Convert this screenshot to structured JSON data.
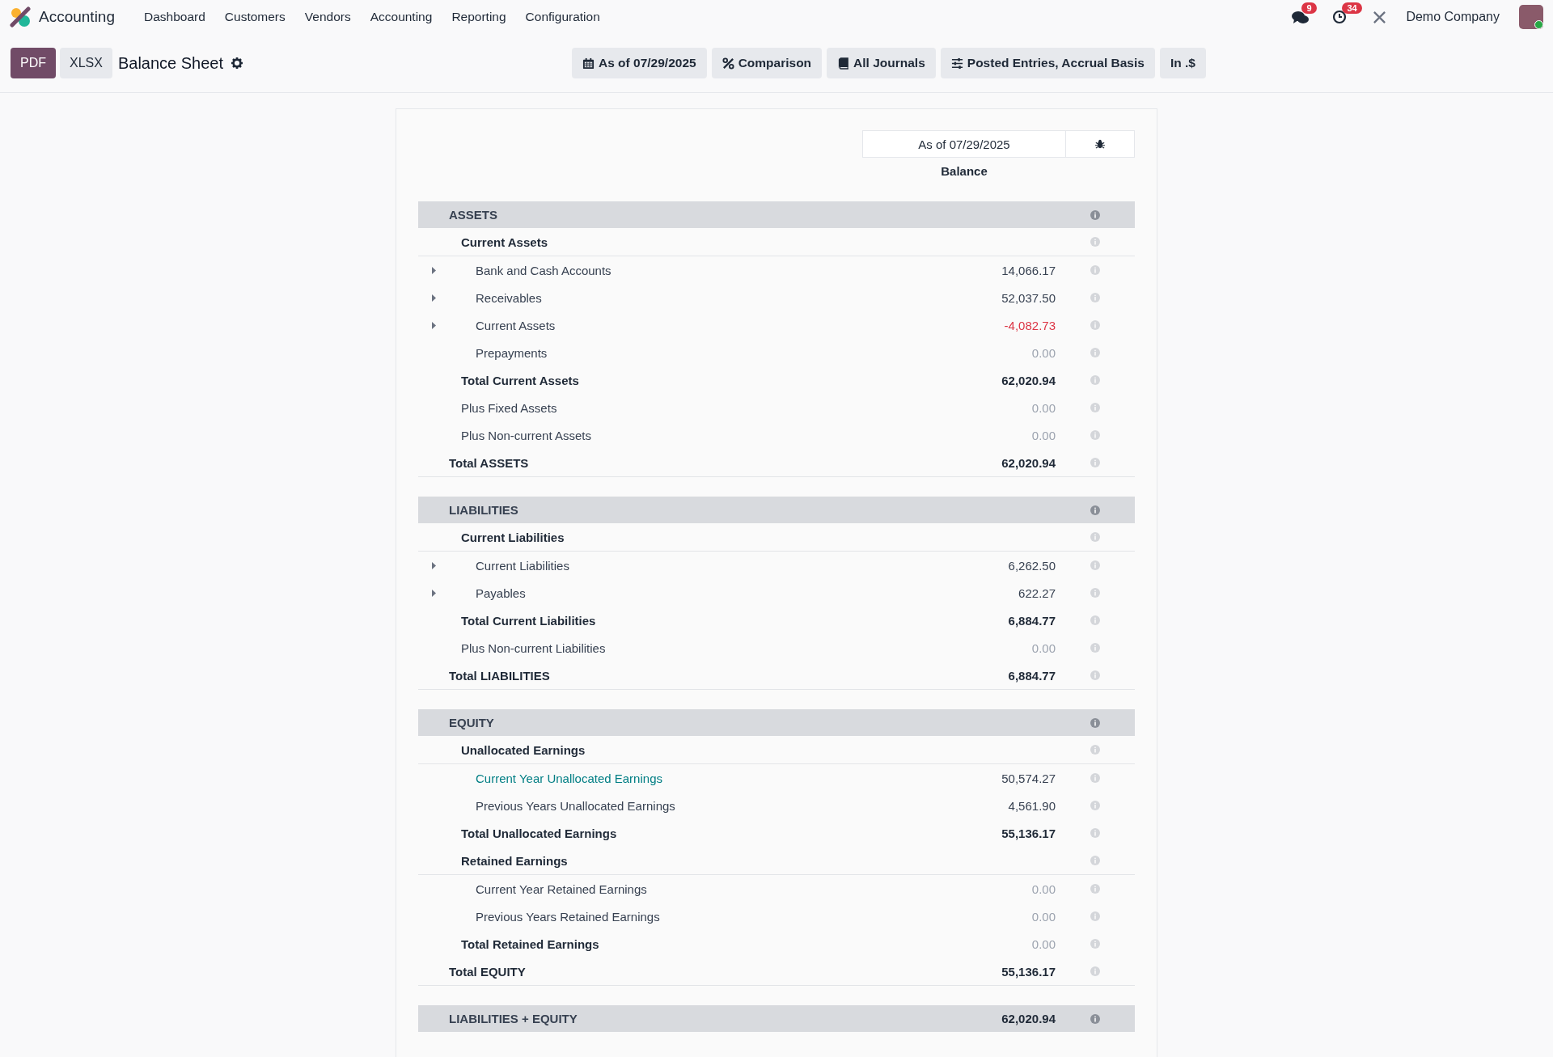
{
  "navbar": {
    "app_name": "Accounting",
    "menu": [
      "Dashboard",
      "Customers",
      "Vendors",
      "Accounting",
      "Reporting",
      "Configuration"
    ],
    "messages_count": "9",
    "activities_count": "34",
    "company": "Demo Company",
    "user_online": true
  },
  "control_panel": {
    "buttons": [
      {
        "label": "PDF",
        "primary": true
      },
      {
        "label": "XLSX",
        "primary": false
      }
    ],
    "title": "Balance Sheet",
    "filters": [
      {
        "kind": "date",
        "label": "As of 07/29/2025"
      },
      {
        "kind": "comparison",
        "label": "Comparison"
      },
      {
        "kind": "journals",
        "label": "All Journals"
      },
      {
        "kind": "options",
        "label": "Posted Entries, Accrual Basis"
      },
      {
        "kind": "currency",
        "label": "In .$"
      }
    ]
  },
  "report": {
    "column_header": "As of 07/29/2025",
    "column_subheader": "Balance",
    "rows": [
      {
        "kind": "section",
        "label": "ASSETS"
      },
      {
        "kind": "group",
        "label": "Current Assets"
      },
      {
        "kind": "line",
        "label": "Bank and Cash Accounts",
        "value": "14,066.17",
        "negative": false,
        "greyed": false,
        "expandable": true,
        "linked": false
      },
      {
        "kind": "line",
        "label": "Receivables",
        "value": "52,037.50",
        "negative": false,
        "greyed": false,
        "expandable": true,
        "linked": false
      },
      {
        "kind": "line",
        "label": "Current Assets",
        "value": "-4,082.73",
        "negative": true,
        "greyed": false,
        "expandable": true,
        "linked": false
      },
      {
        "kind": "line",
        "label": "Prepayments",
        "value": "0.00",
        "negative": false,
        "greyed": true,
        "expandable": false,
        "linked": false
      },
      {
        "kind": "total",
        "label": "Total Current Assets",
        "value": "62,020.94",
        "negative": false,
        "greyed": false
      },
      {
        "kind": "subline",
        "label": "Plus Fixed Assets",
        "value": "0.00",
        "negative": false,
        "greyed": true
      },
      {
        "kind": "subline",
        "label": "Plus Non-current Assets",
        "value": "0.00",
        "negative": false,
        "greyed": true
      },
      {
        "kind": "grand",
        "label": "Total ASSETS",
        "value": "62,020.94",
        "negative": false,
        "greyed": false
      },
      {
        "kind": "section",
        "label": "LIABILITIES"
      },
      {
        "kind": "group",
        "label": "Current Liabilities"
      },
      {
        "kind": "line",
        "label": "Current Liabilities",
        "value": "6,262.50",
        "negative": false,
        "greyed": false,
        "expandable": true,
        "linked": false
      },
      {
        "kind": "line",
        "label": "Payables",
        "value": "622.27",
        "negative": false,
        "greyed": false,
        "expandable": true,
        "linked": false
      },
      {
        "kind": "total",
        "label": "Total Current Liabilities",
        "value": "6,884.77",
        "negative": false,
        "greyed": false
      },
      {
        "kind": "subline",
        "label": "Plus Non-current Liabilities",
        "value": "0.00",
        "negative": false,
        "greyed": true
      },
      {
        "kind": "grand",
        "label": "Total LIABILITIES",
        "value": "6,884.77",
        "negative": false,
        "greyed": false
      },
      {
        "kind": "section",
        "label": "EQUITY"
      },
      {
        "kind": "group",
        "label": "Unallocated Earnings"
      },
      {
        "kind": "line",
        "label": "Current Year Unallocated Earnings",
        "value": "50,574.27",
        "negative": false,
        "greyed": false,
        "expandable": false,
        "linked": true
      },
      {
        "kind": "line",
        "label": "Previous Years Unallocated Earnings",
        "value": "4,561.90",
        "negative": false,
        "greyed": false,
        "expandable": false,
        "linked": false
      },
      {
        "kind": "total",
        "label": "Total Unallocated Earnings",
        "value": "55,136.17",
        "negative": false,
        "greyed": false
      },
      {
        "kind": "group",
        "label": "Retained Earnings"
      },
      {
        "kind": "line",
        "label": "Current Year Retained Earnings",
        "value": "0.00",
        "negative": false,
        "greyed": true,
        "expandable": false,
        "linked": false
      },
      {
        "kind": "line",
        "label": "Previous Years Retained Earnings",
        "value": "0.00",
        "negative": false,
        "greyed": true,
        "expandable": false,
        "linked": false
      },
      {
        "kind": "total",
        "label": "Total Retained Earnings",
        "value": "0.00",
        "negative": false,
        "greyed": true
      },
      {
        "kind": "grand",
        "label": "Total EQUITY",
        "value": "55,136.17",
        "negative": false,
        "greyed": false
      },
      {
        "kind": "section",
        "label": "LIABILITIES + EQUITY",
        "value": "62,020.94",
        "negative": false,
        "greyed": false
      }
    ]
  }
}
